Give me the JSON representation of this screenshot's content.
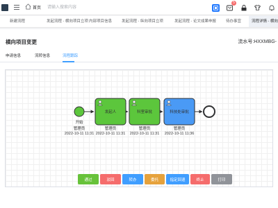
{
  "header": {
    "home_label": "首页",
    "search_placeholder": "请输入搜索内容",
    "notification_count": "5"
  },
  "tabs": [
    {
      "label": "新建流程"
    },
    {
      "label": "发起流程 - 横向项目立项"
    },
    {
      "label": "内部项目信息"
    },
    {
      "label": "发起流程 - 纵向项目立项"
    },
    {
      "label": "发起流程 - 论文成果申报"
    },
    {
      "label": "待办事宜"
    },
    {
      "label": "流程详情 - 横向项目变"
    }
  ],
  "page": {
    "title": "横向项目变更",
    "serial": "流水号:HXXMBG-"
  },
  "subtabs": [
    {
      "label": "申请信息"
    },
    {
      "label": "流转信息"
    },
    {
      "label": "流程跟踪"
    }
  ],
  "diagram": {
    "start": {
      "label": "开始",
      "assignee": "管理员",
      "time": "2022-10-11 11:31"
    },
    "tasks": [
      {
        "label": "发起人",
        "assignee": "管理员",
        "time": "2022-10-11 11:31",
        "state": "completed",
        "color": "#5cc63c"
      },
      {
        "label": "科室审批",
        "assignee": "管理员",
        "time": "2022-10-11 11:31",
        "state": "completed",
        "color": "#5cc63c"
      },
      {
        "label": "科技处审批",
        "assignee": "管理员",
        "time": "2022-10-11 11:36",
        "state": "current",
        "color": "#4a9af5"
      }
    ],
    "end": {
      "label": ""
    }
  },
  "actions": [
    {
      "label": "通过",
      "color": "#67c23a"
    },
    {
      "label": "驳回",
      "color": "#f56c6c"
    },
    {
      "label": "转办",
      "color": "#409eff"
    },
    {
      "label": "委托",
      "color": "#e6a23c"
    },
    {
      "label": "指定回退",
      "color": "#409eff"
    },
    {
      "label": "终止",
      "color": "#f56c6c"
    },
    {
      "label": "打印",
      "color": "#909399"
    }
  ]
}
